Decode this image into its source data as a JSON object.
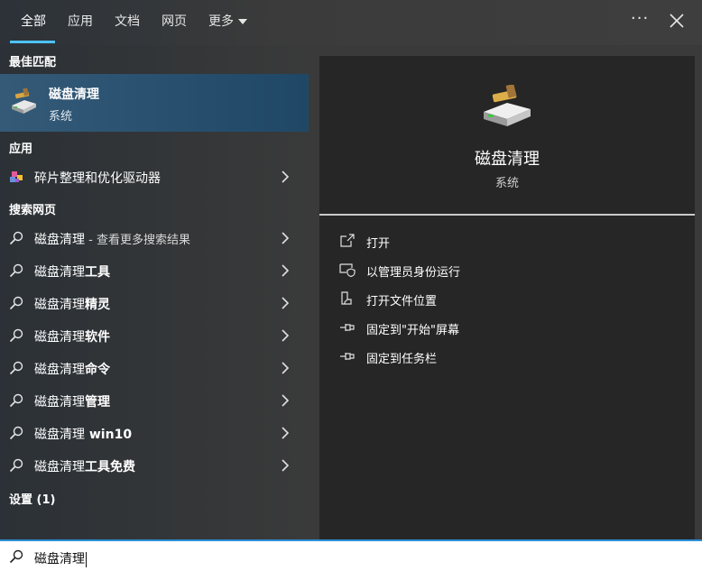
{
  "tabs": [
    {
      "label": "全部"
    },
    {
      "label": "应用"
    },
    {
      "label": "文档"
    },
    {
      "label": "网页"
    },
    {
      "label": "更多"
    }
  ],
  "more_options_glyph": "···",
  "best_match": {
    "heading": "最佳匹配",
    "title": "磁盘清理",
    "subtitle": "系统"
  },
  "apps": {
    "heading": "应用",
    "items": [
      {
        "label": "碎片整理和优化驱动器"
      }
    ]
  },
  "web": {
    "heading": "搜索网页",
    "items": [
      {
        "prefix": "磁盘清理",
        "suffix": " - 查看更多搜索结果"
      },
      {
        "prefix": "磁盘清理",
        "bold": "工具"
      },
      {
        "prefix": "磁盘清理",
        "bold": "精灵"
      },
      {
        "prefix": "磁盘清理",
        "bold": "软件"
      },
      {
        "prefix": "磁盘清理",
        "bold": "命令"
      },
      {
        "prefix": "磁盘清理",
        "bold": "管理"
      },
      {
        "prefix": "磁盘清理",
        "bold": " win10"
      },
      {
        "prefix": "磁盘清理",
        "bold": "工具免费"
      }
    ]
  },
  "settings": {
    "heading": "设置 (1)"
  },
  "preview": {
    "title": "磁盘清理",
    "subtitle": "系统",
    "actions": [
      {
        "label": "打开",
        "icon": "open-icon"
      },
      {
        "label": "以管理员身份运行",
        "icon": "shield-run-icon"
      },
      {
        "label": "打开文件位置",
        "icon": "file-location-icon"
      },
      {
        "label": "固定到\"开始\"屏幕",
        "icon": "pin-icon"
      },
      {
        "label": "固定到任务栏",
        "icon": "pin-icon"
      }
    ]
  },
  "search": {
    "value": "磁盘清理"
  },
  "colors": {
    "accent": "#4cc2ff",
    "selected": "#2a5272",
    "panel": "#262626"
  }
}
